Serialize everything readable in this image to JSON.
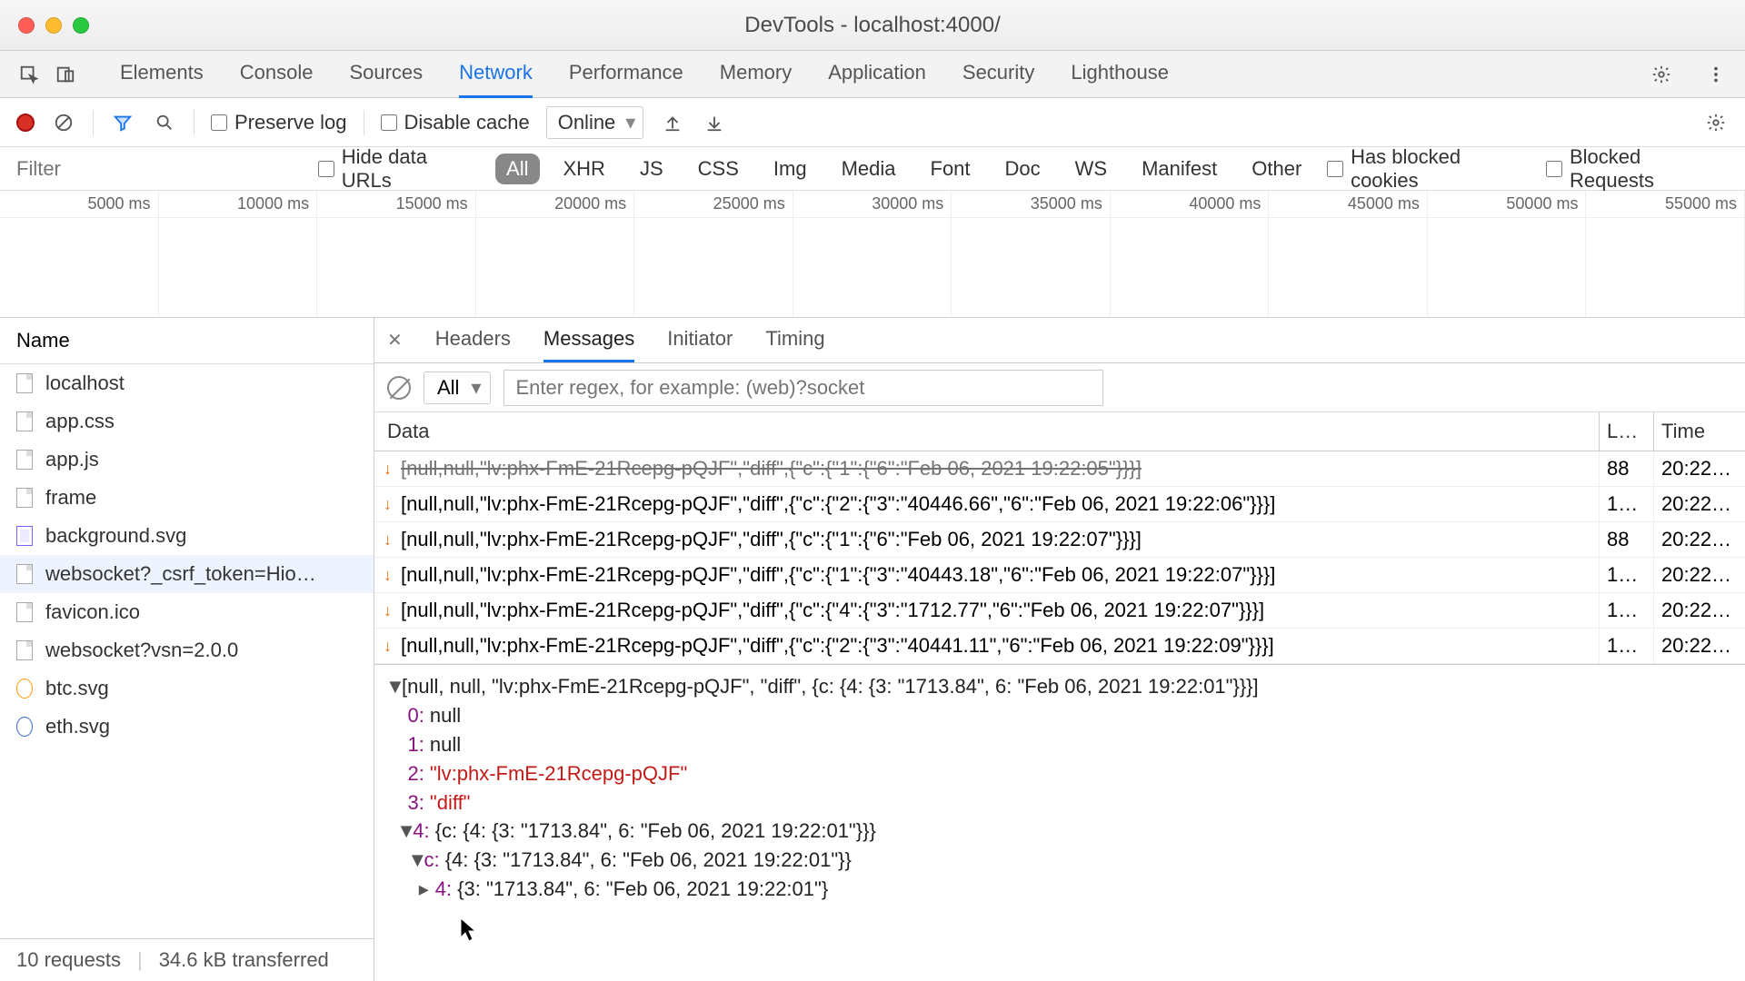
{
  "window": {
    "title": "DevTools - localhost:4000/"
  },
  "tabs": {
    "items": [
      "Elements",
      "Console",
      "Sources",
      "Network",
      "Performance",
      "Memory",
      "Application",
      "Security",
      "Lighthouse"
    ],
    "active": "Network"
  },
  "toolbar": {
    "preserve_log": "Preserve log",
    "disable_cache": "Disable cache",
    "throttle": "Online"
  },
  "filterbar": {
    "filter_placeholder": "Filter",
    "hide_data_urls": "Hide data URLs",
    "types": [
      "All",
      "XHR",
      "JS",
      "CSS",
      "Img",
      "Media",
      "Font",
      "Doc",
      "WS",
      "Manifest",
      "Other"
    ],
    "blocked_cookies": "Has blocked cookies",
    "blocked_requests": "Blocked Requests"
  },
  "timeline": {
    "ticks": [
      "5000 ms",
      "10000 ms",
      "15000 ms",
      "20000 ms",
      "25000 ms",
      "30000 ms",
      "35000 ms",
      "40000 ms",
      "45000 ms",
      "50000 ms",
      "55000 ms"
    ]
  },
  "sidebar": {
    "header": "Name",
    "items": [
      {
        "label": "localhost",
        "kind": "doc"
      },
      {
        "label": "app.css",
        "kind": "doc"
      },
      {
        "label": "app.js",
        "kind": "doc"
      },
      {
        "label": "frame",
        "kind": "doc"
      },
      {
        "label": "background.svg",
        "kind": "svg"
      },
      {
        "label": "websocket?_csrf_token=Hio…",
        "kind": "doc",
        "selected": true
      },
      {
        "label": "favicon.ico",
        "kind": "doc"
      },
      {
        "label": "websocket?vsn=2.0.0",
        "kind": "doc"
      },
      {
        "label": "btc.svg",
        "kind": "img"
      },
      {
        "label": "eth.svg",
        "kind": "img2"
      }
    ]
  },
  "status": {
    "requests": "10 requests",
    "transferred": "34.6 kB transferred"
  },
  "detail_tabs": {
    "items": [
      "Headers",
      "Messages",
      "Initiator",
      "Timing"
    ],
    "active": "Messages"
  },
  "msgfilter": {
    "all": "All",
    "placeholder": "Enter regex, for example: (web)?socket"
  },
  "datahdr": {
    "c1": "Data",
    "c2": "L…",
    "c3": "Time"
  },
  "messages": [
    {
      "data": "[null,null,\"lv:phx-FmE-21Rcepg-pQJF\",\"diff\",{\"c\":{\"1\":{\"6\":\"Feb 06, 2021 19:22:05\"}}}]",
      "len": "88",
      "time": "20:22…",
      "clipped": true
    },
    {
      "data": "[null,null,\"lv:phx-FmE-21Rcepg-pQJF\",\"diff\",{\"c\":{\"2\":{\"3\":\"40446.66\",\"6\":\"Feb 06, 2021 19:22:06\"}}}]",
      "len": "1…",
      "time": "20:22…"
    },
    {
      "data": "[null,null,\"lv:phx-FmE-21Rcepg-pQJF\",\"diff\",{\"c\":{\"1\":{\"6\":\"Feb 06, 2021 19:22:07\"}}}]",
      "len": "88",
      "time": "20:22…"
    },
    {
      "data": "[null,null,\"lv:phx-FmE-21Rcepg-pQJF\",\"diff\",{\"c\":{\"1\":{\"3\":\"40443.18\",\"6\":\"Feb 06, 2021 19:22:07\"}}}]",
      "len": "1…",
      "time": "20:22…"
    },
    {
      "data": "[null,null,\"lv:phx-FmE-21Rcepg-pQJF\",\"diff\",{\"c\":{\"4\":{\"3\":\"1712.77\",\"6\":\"Feb 06, 2021 19:22:07\"}}}]",
      "len": "1…",
      "time": "20:22…"
    },
    {
      "data": "[null,null,\"lv:phx-FmE-21Rcepg-pQJF\",\"diff\",{\"c\":{\"2\":{\"3\":\"40441.11\",\"6\":\"Feb 06, 2021 19:22:09\"}}}]",
      "len": "1…",
      "time": "20:22…"
    }
  ],
  "tree": {
    "root": "[null, null, \"lv:phx-FmE-21Rcepg-pQJF\", \"diff\", {c: {4: {3: \"1713.84\", 6: \"Feb 06, 2021 19:22:01\"}}}]",
    "r0": "null",
    "r1": "null",
    "r2": "\"lv:phx-FmE-21Rcepg-pQJF\"",
    "r3": "\"diff\"",
    "r4": "{c: {4: {3: \"1713.84\", 6: \"Feb 06, 2021 19:22:01\"}}}",
    "rc": "{4: {3: \"1713.84\", 6: \"Feb 06, 2021 19:22:01\"}}",
    "rc4": "{3: \"1713.84\", 6: \"Feb 06, 2021 19:22:01\"}"
  }
}
